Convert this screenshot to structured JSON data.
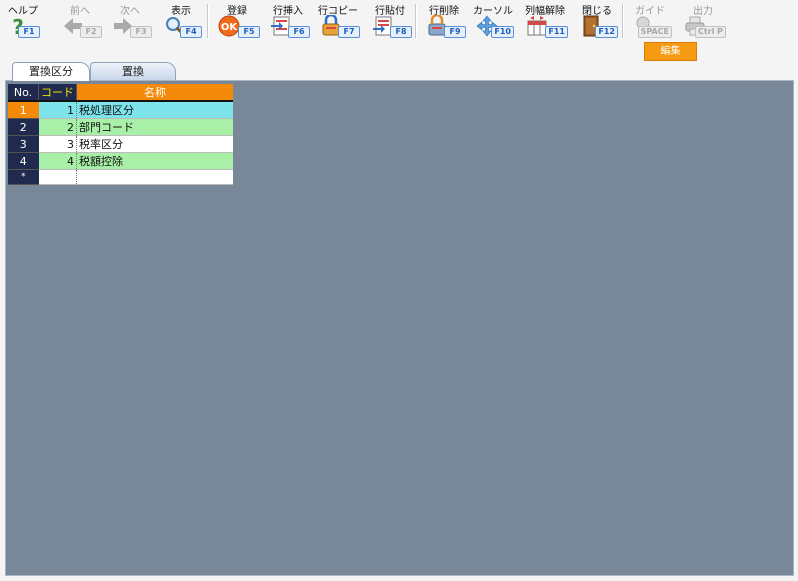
{
  "toolbar": {
    "buttons": [
      {
        "label": "ヘルプ",
        "key": "F1",
        "icon": "help-icon"
      },
      {
        "label": "前へ",
        "key": "F2",
        "icon": "arrow-left-icon"
      },
      {
        "label": "次へ",
        "key": "F3",
        "icon": "arrow-right-icon"
      },
      {
        "label": "表示",
        "key": "F4",
        "icon": "magnifier-icon"
      },
      {
        "label": "登録",
        "key": "F5",
        "icon": "ok-icon"
      },
      {
        "label": "行挿入",
        "key": "F6",
        "icon": "insert-row-icon"
      },
      {
        "label": "行コピー",
        "key": "F7",
        "icon": "copy-row-icon"
      },
      {
        "label": "行貼付",
        "key": "F8",
        "icon": "paste-row-icon"
      },
      {
        "label": "行削除",
        "key": "F9",
        "icon": "delete-row-icon"
      },
      {
        "label": "カーソル",
        "key": "F10",
        "icon": "cursor-icon"
      },
      {
        "label": "列幅解除",
        "key": "F11",
        "icon": "column-width-icon"
      },
      {
        "label": "閉じる",
        "key": "F12",
        "icon": "door-close-icon"
      },
      {
        "label": "ガイド",
        "key": "SPACE",
        "icon": "lightbulb-icon"
      },
      {
        "label": "出力",
        "key": "Ctrl P",
        "icon": "printer-icon"
      }
    ],
    "edit_mode": "編集"
  },
  "tabs": [
    {
      "label": "置換区分",
      "active": true
    },
    {
      "label": "置換",
      "active": false
    }
  ],
  "grid": {
    "headers": {
      "no": "No.",
      "code": "コード",
      "name": "名称"
    },
    "rows": [
      {
        "no": "1",
        "code": "1",
        "name": "税処理区分"
      },
      {
        "no": "2",
        "code": "2",
        "name": "部門コード"
      },
      {
        "no": "3",
        "code": "3",
        "name": "税率区分"
      },
      {
        "no": "4",
        "code": "4",
        "name": "税額控除"
      }
    ],
    "new_row_marker": "*"
  },
  "colors": {
    "header_dark": "#1f2a4e",
    "header_accent": "#f58a0a",
    "row_selected": "#7ee4ec",
    "row_alt": "#a8f0a8",
    "workspace": "#788898"
  }
}
